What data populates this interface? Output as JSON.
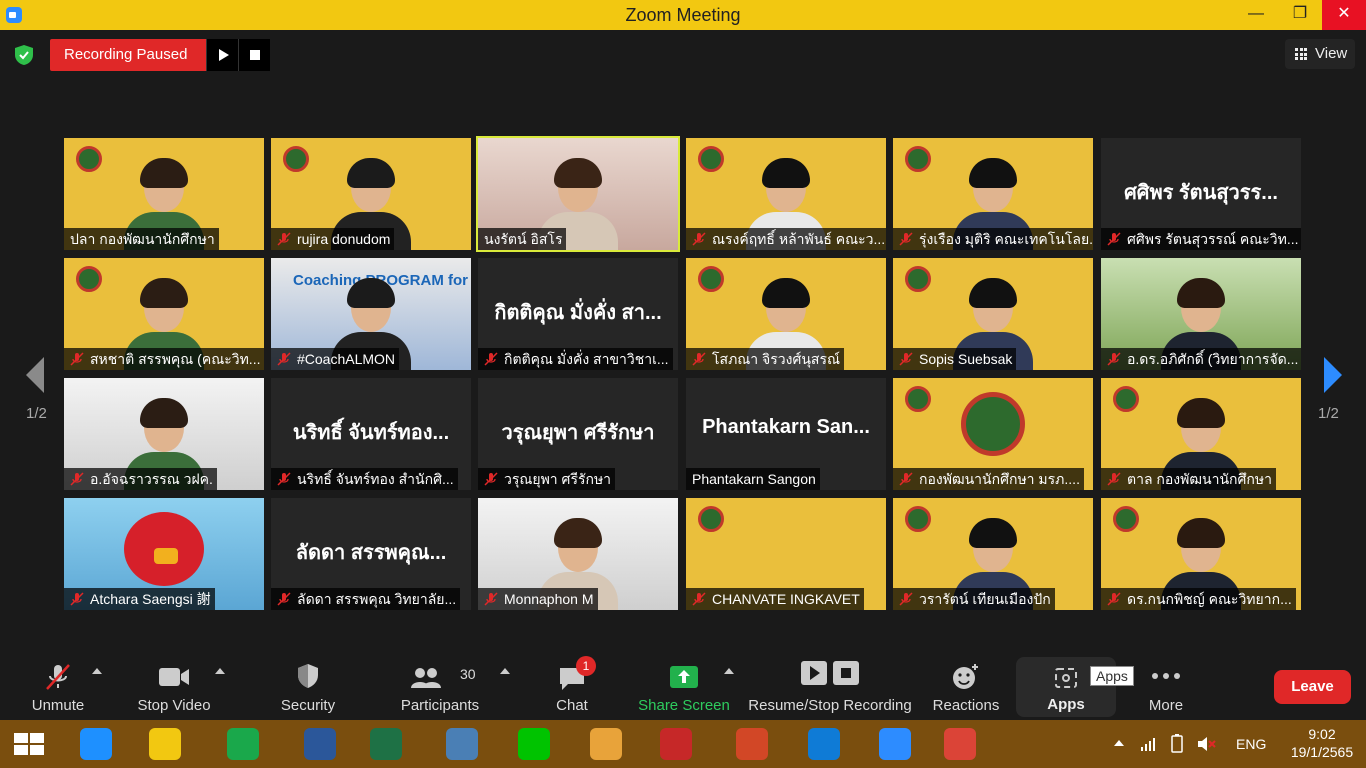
{
  "window": {
    "title": "Zoom Meeting",
    "minimize": "—",
    "maximize": "❐",
    "close": "✕"
  },
  "recording": {
    "status": "Recording Paused"
  },
  "view_button": {
    "label": "View"
  },
  "pagination": {
    "left": "1/2",
    "right": "1/2"
  },
  "tiles": [
    {
      "name": "ปลา กองพัฒนานักศึกษา",
      "muted": false,
      "bg": "slide",
      "person": true
    },
    {
      "name": "rujira donudom",
      "muted": true,
      "bg": "slide",
      "person": true
    },
    {
      "name": "นงรัตน์ อิสโร",
      "muted": false,
      "bg": "photo1",
      "person": true,
      "active": true
    },
    {
      "name": "ณรงค์ฤทธิ์ หล้าพันธ์ คณะว...",
      "muted": true,
      "bg": "slide",
      "person": true
    },
    {
      "name": "รุ่งเรือง มุติริ คณะเทคโนโลย...",
      "muted": true,
      "bg": "slide",
      "person": true
    },
    {
      "name": "ศศิพร รัตนสุวรรณ์ คณะวิท...",
      "muted": true,
      "bg": "dark",
      "display": "ศศิพร รัตนสุวรร..."
    },
    {
      "name": "สหชาติ สรรพคุณ (คณะวิท...",
      "muted": true,
      "bg": "slide",
      "person": true
    },
    {
      "name": "#CoachALMON",
      "muted": true,
      "bg": "coach",
      "person": true,
      "slide_text": "Coaching PROGRAM for"
    },
    {
      "name": "กิตติคุณ  มั่งคั่ง สาขาวิชาเ...",
      "muted": true,
      "bg": "dark",
      "display": "กิตติคุณ  มั่งคั่ง สา..."
    },
    {
      "name": "โสภณา จิรวงศ์นุสรณ์",
      "muted": true,
      "bg": "slide",
      "person": true
    },
    {
      "name": "Sopis Suebsak",
      "muted": true,
      "bg": "slide",
      "person": true
    },
    {
      "name": "อ.ดร.อภิศักดิ์ (วิทยาการจัด...",
      "muted": true,
      "bg": "grass",
      "person": true
    },
    {
      "name": "อ.อัจฉราวรรณ วฝค.",
      "muted": true,
      "bg": "photo2",
      "person": true
    },
    {
      "name": "นริทธิ์ จันทร์ทอง สำนักศิ...",
      "muted": true,
      "bg": "dark",
      "display": "นริทธิ์ จันทร์ทอง..."
    },
    {
      "name": "วรุณยุพา ศรีรักษา",
      "muted": true,
      "bg": "dark",
      "display": "วรุณยุพา ศรีรักษา"
    },
    {
      "name": "Phantakarn Sangon",
      "muted": false,
      "bg": "dark",
      "display": "Phantakarn San..."
    },
    {
      "name": "กองพัฒนานักศึกษา มรภ....",
      "muted": true,
      "bg": "slide",
      "person": false
    },
    {
      "name": "ตาล กองพัฒนานักศึกษา",
      "muted": true,
      "bg": "slide",
      "person": true
    },
    {
      "name": "Atchara Saengsi 謝",
      "muted": true,
      "bg": "bird",
      "person": false
    },
    {
      "name": "ลัดดา สรรพคุณ  วิทยาลัย...",
      "muted": true,
      "bg": "dark",
      "display": "ลัดดา สรรพคุณ..."
    },
    {
      "name": "Monnaphon M",
      "muted": true,
      "bg": "photo2",
      "person": true
    },
    {
      "name": "CHANVATE INGKAVET",
      "muted": true,
      "bg": "slide",
      "person": false
    },
    {
      "name": "วรารัตน์ เทียนเมืองปัก",
      "muted": true,
      "bg": "slide",
      "person": true
    },
    {
      "name": "ดร.กนกพิชญ์ คณะวิทยาก...",
      "muted": true,
      "bg": "slide",
      "person": true
    }
  ],
  "toolbar": {
    "unmute": "Unmute",
    "stop_video": "Stop Video",
    "security": "Security",
    "participants": "Participants",
    "participant_count": "30",
    "chat": "Chat",
    "chat_badge": "1",
    "share_screen": "Share Screen",
    "recording": "Resume/Stop Recording",
    "reactions": "Reactions",
    "apps": "Apps",
    "apps_tooltip": "Apps",
    "more": "More",
    "leave": "Leave"
  },
  "taskbar": {
    "language": "ENG",
    "time": "9:02",
    "date": "19/1/2565",
    "icons": [
      "windows-start-icon",
      "internet-explorer-icon",
      "file-explorer-icon",
      "store-icon",
      "word-icon",
      "excel-icon",
      "calculator-icon",
      "line-icon",
      "paint-icon",
      "lisrel-icon",
      "powerpoint-icon",
      "edge-icon",
      "zoom-icon",
      "chrome-icon"
    ]
  },
  "colors": {
    "titlebar": "#f2c811",
    "recording": "#e02828",
    "active_speaker": "#d9ea3a",
    "share": "#22b14c",
    "taskbar": "#7a4e0e"
  }
}
